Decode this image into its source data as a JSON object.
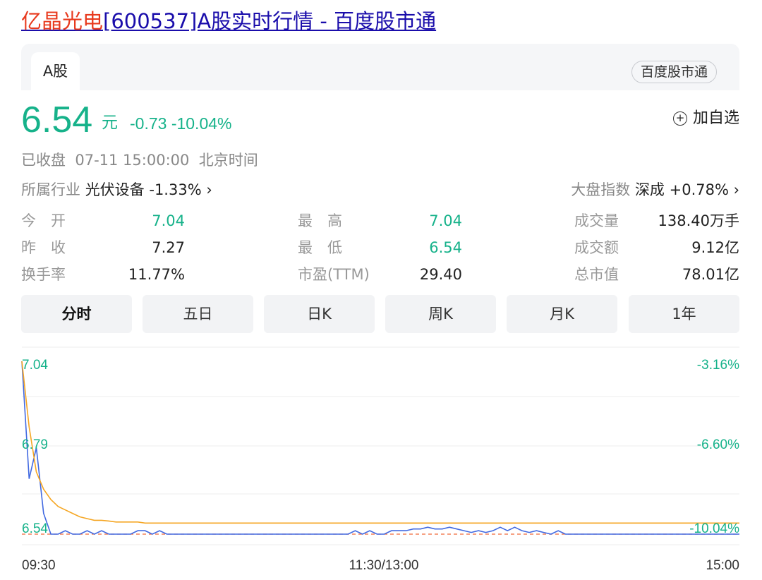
{
  "page": {
    "title_highlight": "亿晶光电",
    "title_rest": "[600537]A股实时行情 - 百度股市通"
  },
  "card": {
    "tab_label": "A股",
    "source_badge": "百度股市通"
  },
  "quote": {
    "price": "6.54",
    "unit": "元",
    "change": "-0.73 -10.04%",
    "add_watch": "加自选",
    "status": "已收盘  07-11 15:00:00  北京时间"
  },
  "industry": {
    "label": "所属行业",
    "value": "光伏设备 -1.33% ›"
  },
  "market": {
    "label": "大盘指数",
    "value": "深成 +0.78% ›"
  },
  "stats": {
    "open_label": "今　开",
    "open_value": "7.04",
    "prev_close_label": "昨　收",
    "prev_close_value": "7.27",
    "turnover_rate_label": "换手率",
    "turnover_rate_value": "11.77%",
    "high_label": "最　高",
    "high_value": "7.04",
    "low_label": "最　低",
    "low_value": "6.54",
    "pe_label": "市盈(TTM)",
    "pe_value": "29.40",
    "volume_label": "成交量",
    "volume_value": "138.40万手",
    "amount_label": "成交额",
    "amount_value": "9.12亿",
    "market_cap_label": "总市值",
    "market_cap_value": "78.01亿"
  },
  "periods": [
    "分时",
    "五日",
    "日K",
    "周K",
    "月K",
    "1年"
  ],
  "colors": {
    "down": "#16b28a",
    "price_line": "#4169e1",
    "avg_line": "#f5a623",
    "ref_line": "#f06a3a"
  },
  "chart_data": {
    "type": "line",
    "x_labels": [
      "09:30",
      "11:30/13:00",
      "15:00"
    ],
    "y_left_ticks": [
      "7.04",
      "6.79",
      "6.54"
    ],
    "y_right_ticks": [
      "-3.16%",
      "-6.60%",
      "-10.04%"
    ],
    "ylim": [
      6.54,
      7.04
    ],
    "series": [
      {
        "values": [
          7.04,
          6.7,
          6.79,
          6.6,
          6.54,
          6.54,
          6.55,
          6.54,
          6.54,
          6.55,
          6.54,
          6.55,
          6.54,
          6.54,
          6.54,
          6.54,
          6.55,
          6.55,
          6.54,
          6.55,
          6.54,
          6.54,
          6.54,
          6.54,
          6.54,
          6.54,
          6.54,
          6.54,
          6.54,
          6.54,
          6.54,
          6.54,
          6.54,
          6.54,
          6.54,
          6.54,
          6.54,
          6.54,
          6.54,
          6.54,
          6.54,
          6.54,
          6.54,
          6.54,
          6.54,
          6.54,
          6.55,
          6.54,
          6.55,
          6.54,
          6.54,
          6.55,
          6.55,
          6.55,
          6.555,
          6.555,
          6.56,
          6.555,
          6.555,
          6.56,
          6.555,
          6.55,
          6.545,
          6.55,
          6.545,
          6.55,
          6.56,
          6.55,
          6.56,
          6.55,
          6.545,
          6.55,
          6.545,
          6.54,
          6.55,
          6.54,
          6.54,
          6.54,
          6.54,
          6.54,
          6.54,
          6.54,
          6.54,
          6.54,
          6.54,
          6.54,
          6.54,
          6.54,
          6.54,
          6.54,
          6.54,
          6.54,
          6.54,
          6.54,
          6.54,
          6.54,
          6.54,
          6.54,
          6.54,
          6.54
        ]
      },
      {
        "values": [
          7.04,
          6.85,
          6.72,
          6.67,
          6.64,
          6.62,
          6.61,
          6.6,
          6.59,
          6.585,
          6.58,
          6.58,
          6.578,
          6.575,
          6.575,
          6.575,
          6.575,
          6.572,
          6.572,
          6.572,
          6.572,
          6.572,
          6.572,
          6.572,
          6.572,
          6.572,
          6.572,
          6.572,
          6.572,
          6.572,
          6.572,
          6.572,
          6.572,
          6.572,
          6.572,
          6.572,
          6.572,
          6.572,
          6.572,
          6.572,
          6.572,
          6.572,
          6.572,
          6.572,
          6.572,
          6.572,
          6.572,
          6.572,
          6.572,
          6.572,
          6.572,
          6.572,
          6.572,
          6.572,
          6.572,
          6.572,
          6.572,
          6.572,
          6.572,
          6.572,
          6.572,
          6.572,
          6.572,
          6.572,
          6.572,
          6.572,
          6.572,
          6.572,
          6.572,
          6.572,
          6.572,
          6.572,
          6.572,
          6.572,
          6.572,
          6.572,
          6.572,
          6.572,
          6.572,
          6.572,
          6.572,
          6.572,
          6.572,
          6.572,
          6.572,
          6.572,
          6.572,
          6.572,
          6.572,
          6.572,
          6.572,
          6.572,
          6.572,
          6.572,
          6.572,
          6.572,
          6.572,
          6.572,
          6.572,
          6.572
        ]
      }
    ],
    "reference_value": 6.54
  }
}
